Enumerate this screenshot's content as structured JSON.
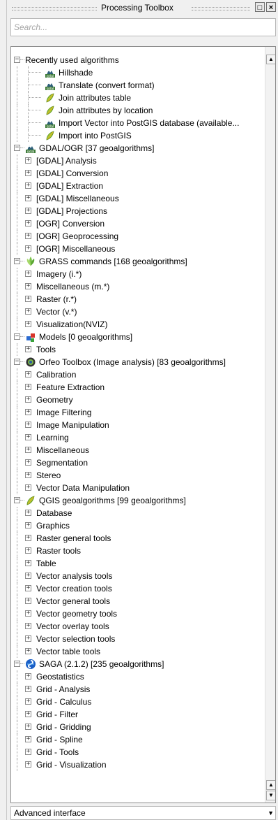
{
  "panel": {
    "title": "Processing Toolbox"
  },
  "search": {
    "placeholder": "Search..."
  },
  "mode_select": {
    "value": "Advanced interface"
  },
  "icons": {
    "float": "float-window-icon",
    "close": "close-icon",
    "gdal": "gdal-icon",
    "python": "python-icon",
    "grass": "grass-icon",
    "models": "models-icon",
    "otb": "otb-icon",
    "saga": "saga-icon"
  },
  "tree": [
    {
      "label": "Recently used algorithms",
      "level": 0,
      "expander": "-",
      "icon": ""
    },
    {
      "label": "Hillshade",
      "level": 1,
      "expander": "",
      "icon": "gdal"
    },
    {
      "label": "Translate (convert format)",
      "level": 1,
      "expander": "",
      "icon": "gdal"
    },
    {
      "label": "Join attributes table",
      "level": 1,
      "expander": "",
      "icon": "python"
    },
    {
      "label": "Join attributes by location",
      "level": 1,
      "expander": "",
      "icon": "python"
    },
    {
      "label": "Import Vector into PostGIS database (available...",
      "level": 1,
      "expander": "",
      "icon": "gdal"
    },
    {
      "label": "Import into PostGIS",
      "level": 1,
      "expander": "",
      "icon": "python"
    },
    {
      "label": "GDAL/OGR [37 geoalgorithms]",
      "level": 0,
      "expander": "-",
      "icon": "gdal"
    },
    {
      "label": "[GDAL] Analysis",
      "level": 1,
      "expander": "+",
      "icon": ""
    },
    {
      "label": "[GDAL] Conversion",
      "level": 1,
      "expander": "+",
      "icon": ""
    },
    {
      "label": "[GDAL] Extraction",
      "level": 1,
      "expander": "+",
      "icon": ""
    },
    {
      "label": "[GDAL] Miscellaneous",
      "level": 1,
      "expander": "+",
      "icon": ""
    },
    {
      "label": "[GDAL] Projections",
      "level": 1,
      "expander": "+",
      "icon": ""
    },
    {
      "label": "[OGR] Conversion",
      "level": 1,
      "expander": "+",
      "icon": ""
    },
    {
      "label": "[OGR] Geoprocessing",
      "level": 1,
      "expander": "+",
      "icon": ""
    },
    {
      "label": "[OGR] Miscellaneous",
      "level": 1,
      "expander": "+",
      "icon": ""
    },
    {
      "label": "GRASS commands [168 geoalgorithms]",
      "level": 0,
      "expander": "-",
      "icon": "grass"
    },
    {
      "label": "Imagery (i.*)",
      "level": 1,
      "expander": "+",
      "icon": ""
    },
    {
      "label": "Miscellaneous (m.*)",
      "level": 1,
      "expander": "+",
      "icon": ""
    },
    {
      "label": "Raster (r.*)",
      "level": 1,
      "expander": "+",
      "icon": ""
    },
    {
      "label": "Vector (v.*)",
      "level": 1,
      "expander": "+",
      "icon": ""
    },
    {
      "label": "Visualization(NVIZ)",
      "level": 1,
      "expander": "+",
      "icon": ""
    },
    {
      "label": "Models [0 geoalgorithms]",
      "level": 0,
      "expander": "-",
      "icon": "models"
    },
    {
      "label": "Tools",
      "level": 1,
      "expander": "+",
      "icon": ""
    },
    {
      "label": "Orfeo Toolbox (Image analysis) [83 geoalgorithms]",
      "level": 0,
      "expander": "-",
      "icon": "otb"
    },
    {
      "label": "Calibration",
      "level": 1,
      "expander": "+",
      "icon": ""
    },
    {
      "label": "Feature Extraction",
      "level": 1,
      "expander": "+",
      "icon": ""
    },
    {
      "label": "Geometry",
      "level": 1,
      "expander": "+",
      "icon": ""
    },
    {
      "label": "Image Filtering",
      "level": 1,
      "expander": "+",
      "icon": ""
    },
    {
      "label": "Image Manipulation",
      "level": 1,
      "expander": "+",
      "icon": ""
    },
    {
      "label": "Learning",
      "level": 1,
      "expander": "+",
      "icon": ""
    },
    {
      "label": "Miscellaneous",
      "level": 1,
      "expander": "+",
      "icon": ""
    },
    {
      "label": "Segmentation",
      "level": 1,
      "expander": "+",
      "icon": ""
    },
    {
      "label": "Stereo",
      "level": 1,
      "expander": "+",
      "icon": ""
    },
    {
      "label": "Vector Data Manipulation",
      "level": 1,
      "expander": "+",
      "icon": ""
    },
    {
      "label": "QGIS geoalgorithms [99 geoalgorithms]",
      "level": 0,
      "expander": "-",
      "icon": "python"
    },
    {
      "label": "Database",
      "level": 1,
      "expander": "+",
      "icon": ""
    },
    {
      "label": "Graphics",
      "level": 1,
      "expander": "+",
      "icon": ""
    },
    {
      "label": "Raster general tools",
      "level": 1,
      "expander": "+",
      "icon": ""
    },
    {
      "label": "Raster tools",
      "level": 1,
      "expander": "+",
      "icon": ""
    },
    {
      "label": "Table",
      "level": 1,
      "expander": "+",
      "icon": ""
    },
    {
      "label": "Vector analysis tools",
      "level": 1,
      "expander": "+",
      "icon": ""
    },
    {
      "label": "Vector creation tools",
      "level": 1,
      "expander": "+",
      "icon": ""
    },
    {
      "label": "Vector general tools",
      "level": 1,
      "expander": "+",
      "icon": ""
    },
    {
      "label": "Vector geometry tools",
      "level": 1,
      "expander": "+",
      "icon": ""
    },
    {
      "label": "Vector overlay tools",
      "level": 1,
      "expander": "+",
      "icon": ""
    },
    {
      "label": "Vector selection tools",
      "level": 1,
      "expander": "+",
      "icon": ""
    },
    {
      "label": "Vector table tools",
      "level": 1,
      "expander": "+",
      "icon": ""
    },
    {
      "label": "SAGA (2.1.2) [235 geoalgorithms]",
      "level": 0,
      "expander": "-",
      "icon": "saga"
    },
    {
      "label": "Geostatistics",
      "level": 1,
      "expander": "+",
      "icon": ""
    },
    {
      "label": "Grid - Analysis",
      "level": 1,
      "expander": "+",
      "icon": ""
    },
    {
      "label": "Grid - Calculus",
      "level": 1,
      "expander": "+",
      "icon": ""
    },
    {
      "label": "Grid - Filter",
      "level": 1,
      "expander": "+",
      "icon": ""
    },
    {
      "label": "Grid - Gridding",
      "level": 1,
      "expander": "+",
      "icon": ""
    },
    {
      "label": "Grid - Spline",
      "level": 1,
      "expander": "+",
      "icon": ""
    },
    {
      "label": "Grid - Tools",
      "level": 1,
      "expander": "+",
      "icon": ""
    },
    {
      "label": "Grid - Visualization",
      "level": 1,
      "expander": "+",
      "icon": ""
    }
  ]
}
